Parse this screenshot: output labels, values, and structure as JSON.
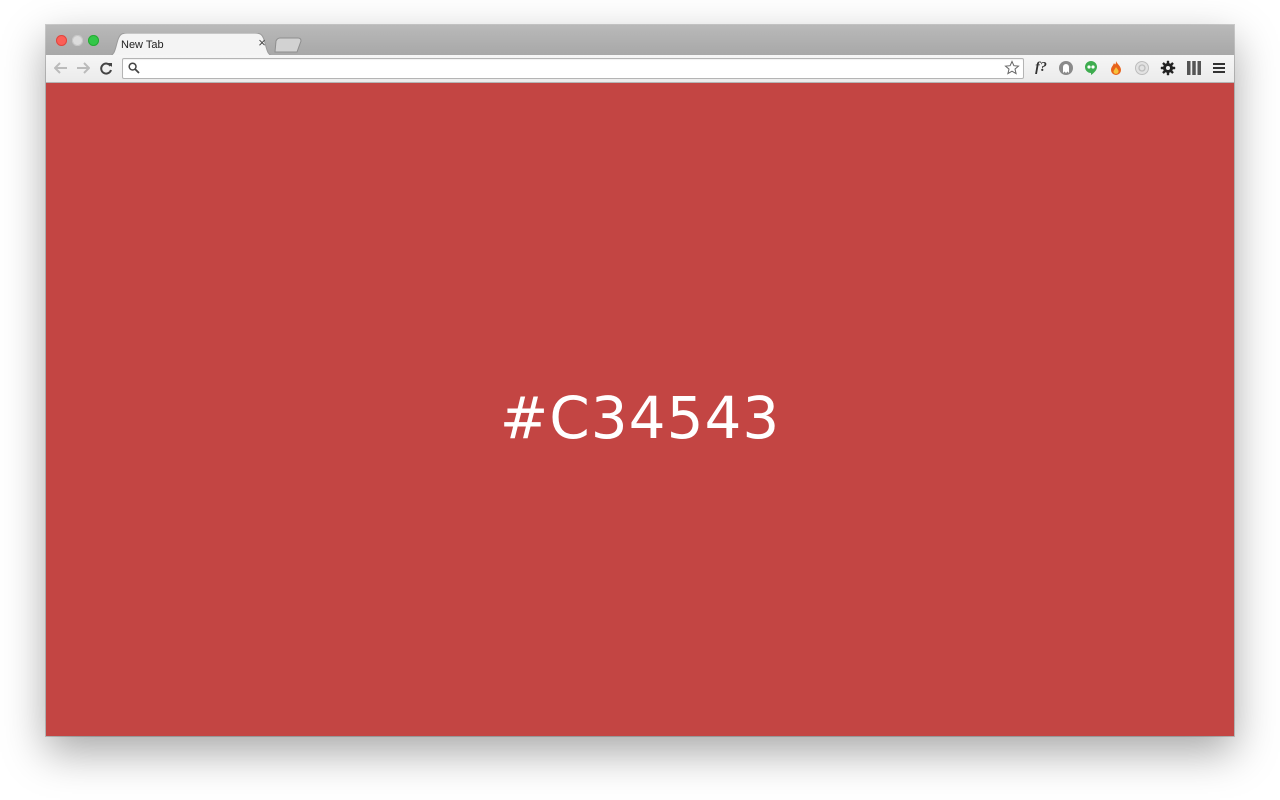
{
  "browser": {
    "tab": {
      "title": "New Tab",
      "close_glyph": "×"
    },
    "omnibox": {
      "value": "",
      "placeholder": ""
    },
    "extensions": [
      {
        "name": "f-question-icon",
        "label": "f?"
      },
      {
        "name": "ghostery-icon"
      },
      {
        "name": "hangouts-icon"
      },
      {
        "name": "fire-icon"
      },
      {
        "name": "grey-circle-icon"
      },
      {
        "name": "gear-icon"
      },
      {
        "name": "columns-icon"
      },
      {
        "name": "menu-icon"
      }
    ]
  },
  "page": {
    "background_color": "#C34543",
    "hex_label": "#C34543"
  },
  "colors": {
    "accent": "#c34543",
    "traffic_close": "#fc5f57",
    "traffic_max": "#33c748"
  }
}
